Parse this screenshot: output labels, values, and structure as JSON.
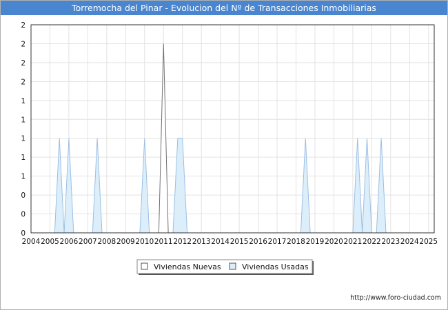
{
  "chart_data": {
    "type": "area",
    "title": "Torremocha del Pinar - Evolucion del Nº de Transacciones Inmobiliarias",
    "xlabel": "",
    "ylabel": "",
    "x_ticks": [
      "2004",
      "2005",
      "2006",
      "2007",
      "2008",
      "2009",
      "2010",
      "2011",
      "2012",
      "2013",
      "2014",
      "2015",
      "2016",
      "2017",
      "2018",
      "2019",
      "2020",
      "2021",
      "2022",
      "2023",
      "2024",
      "2025"
    ],
    "y_ticks": [
      "0",
      "0",
      "0",
      "1",
      "1",
      "1",
      "1",
      "1",
      "2",
      "2",
      "2",
      "2"
    ],
    "xlim": [
      2004,
      2025.3
    ],
    "ylim": [
      0,
      2.2
    ],
    "grid": true,
    "legend_position": "bottom-center",
    "series": [
      {
        "name": "Viviendas Nuevas",
        "color": "#ffffff",
        "line_color": "#707070",
        "x": [
          2004,
          2010.75,
          2011,
          2011.25,
          2025
        ],
        "y": [
          0,
          0,
          2,
          0,
          0
        ]
      },
      {
        "name": "Viviendas Usadas",
        "color": "#ddeefb",
        "line_color": "#9bbfe3",
        "x": [
          2004,
          2005.25,
          2005.5,
          2005.75,
          2006,
          2006.25,
          2007.25,
          2007.5,
          2007.75,
          2009.75,
          2010,
          2010.25,
          2011.5,
          2011.75,
          2012,
          2012.25,
          2018.25,
          2018.5,
          2018.75,
          2021.0,
          2021.25,
          2021.5,
          2021.75,
          2022.0,
          2022.25,
          2022.5,
          2022.75,
          2025
        ],
        "y": [
          0,
          0,
          1,
          0,
          1,
          0,
          0,
          1,
          0,
          0,
          1,
          0,
          0,
          1,
          1,
          0,
          0,
          1,
          0,
          0,
          1,
          0,
          1,
          0,
          0,
          1,
          0,
          0
        ]
      }
    ]
  },
  "footer": {
    "url": "http://www.foro-ciudad.com"
  }
}
